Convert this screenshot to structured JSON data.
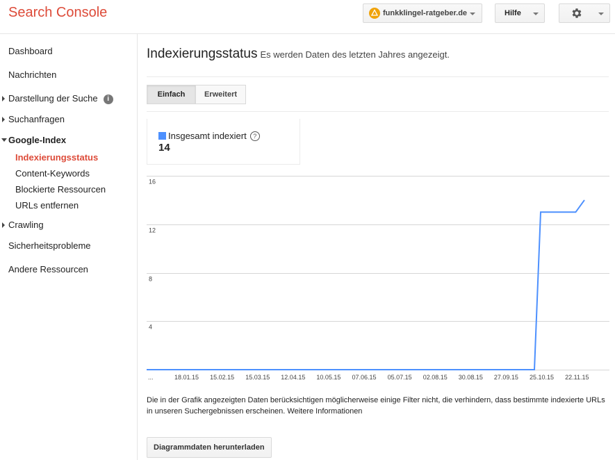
{
  "header": {
    "app_title": "Search Console",
    "site": "funkklingel-ratgeber.de",
    "help": "Hilfe"
  },
  "sidebar": {
    "items": [
      {
        "label": "Dashboard"
      },
      {
        "label": "Nachrichten"
      },
      {
        "label": "Darstellung der Suche"
      },
      {
        "label": "Suchanfragen"
      },
      {
        "label": "Google-Index"
      },
      {
        "label": "Crawling"
      },
      {
        "label": "Sicherheitsprobleme"
      },
      {
        "label": "Andere Ressourcen"
      }
    ],
    "sub_items": [
      {
        "label": "Indexierungsstatus",
        "active": true
      },
      {
        "label": "Content-Keywords"
      },
      {
        "label": "Blockierte Ressourcen"
      },
      {
        "label": "URLs entfernen"
      }
    ]
  },
  "main": {
    "title": "Indexierungsstatus",
    "subtitle": "Es werden Daten des letzten Jahres angezeigt.",
    "tabs": [
      {
        "label": "Einfach",
        "active": true
      },
      {
        "label": "Erweitert"
      }
    ],
    "metric": {
      "label": "Insgesamt indexiert",
      "value": "14"
    },
    "footnote": "Die in der Grafik angezeigten Daten berücksichtigen möglicherweise einige Filter nicht, die verhindern, dass bestimmte indexierte URLs in unseren Suchergebnissen erscheinen. Weitere Informationen",
    "download_label": "Diagrammdaten herunterladen"
  },
  "colors": {
    "brand": "#dd4b39",
    "series": "#4d90fe",
    "site_icon": "#f0a30a"
  },
  "chart_data": {
    "type": "line",
    "grid": true,
    "legend": "none",
    "ylim": [
      0,
      16
    ],
    "y_ticks": [
      "16",
      "12",
      "8",
      "4"
    ],
    "x_ticks": [
      "...",
      "18.01.15",
      "15.02.15",
      "15.03.15",
      "12.04.15",
      "10.05.15",
      "07.06.15",
      "05.07.15",
      "02.08.15",
      "30.08.15",
      "27.09.15",
      "25.10.15",
      "22.11.15"
    ],
    "series": [
      {
        "points": [
          {
            "x": "2014-12-21",
            "y": 0
          },
          {
            "x": "2015-10-27",
            "y": 0
          },
          {
            "x": "2015-11-01",
            "y": 13
          },
          {
            "x": "2015-11-29",
            "y": 13
          },
          {
            "x": "2015-12-06",
            "y": 14
          }
        ]
      }
    ]
  }
}
